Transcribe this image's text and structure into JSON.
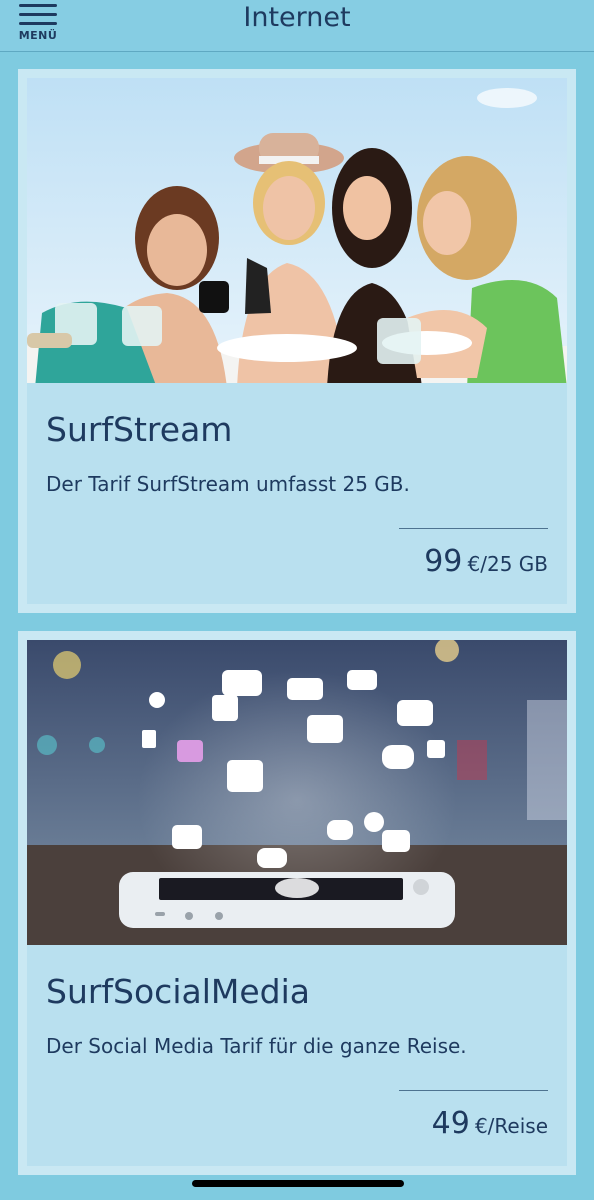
{
  "header": {
    "menu_label": "MENÜ",
    "title": "Internet"
  },
  "cards": [
    {
      "title": "SurfStream",
      "description": "Der Tarif SurfStream umfasst 25 GB.",
      "price_value": "99",
      "price_unit": "€/25 GB"
    },
    {
      "title": "SurfSocialMedia",
      "description": "Der Social Media Tarif für die ganze Reise.",
      "price_value": "49",
      "price_unit": "€/Reise"
    }
  ],
  "colors": {
    "background": "#7fcbe0",
    "card": "#b9e0ef",
    "text": "#1e3a5f"
  }
}
